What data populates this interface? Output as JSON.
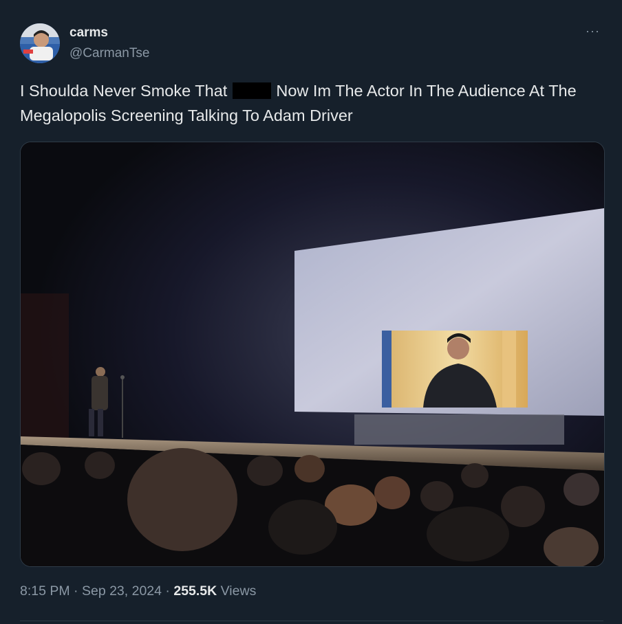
{
  "author": {
    "display_name": "carms",
    "handle": "@CarmanTse",
    "avatar_icon": "avatar-photo"
  },
  "more_label": "···",
  "tweet": {
    "text_before": "I Shoulda Never Smoke That ",
    "text_after": " Now Im The Actor In The Audience At The Megalopolis Screening Talking To Adam Driver"
  },
  "media": {
    "icon": "theater-photo"
  },
  "meta": {
    "time": "8:15 PM",
    "separator": "·",
    "date": "Sep 23, 2024",
    "views_count": "255.5K",
    "views_label": "Views"
  },
  "colors": {
    "background": "#16202b",
    "text_primary": "#e7e9ea",
    "text_secondary": "#8b98a5"
  }
}
